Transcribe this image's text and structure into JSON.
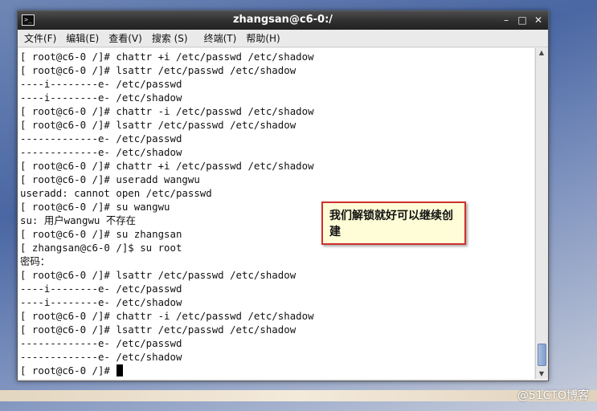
{
  "window": {
    "title": "zhangsan@c6-0:/",
    "controls": {
      "minimize": "–",
      "maximize": "□",
      "close": "✕"
    }
  },
  "menu": [
    {
      "label": "文件(F)"
    },
    {
      "label": "编辑(E)"
    },
    {
      "label": "查看(V)"
    },
    {
      "label": "搜索 (S)"
    },
    {
      "label": "终端(T)"
    },
    {
      "label": "帮助(H)"
    }
  ],
  "terminal": {
    "lines": [
      "[ root@c6-0 /]# chattr +i /etc/passwd /etc/shadow",
      "[ root@c6-0 /]# lsattr /etc/passwd /etc/shadow",
      "----i--------e- /etc/passwd",
      "----i--------e- /etc/shadow",
      "[ root@c6-0 /]# chattr -i /etc/passwd /etc/shadow",
      "[ root@c6-0 /]# lsattr /etc/passwd /etc/shadow",
      "-------------e- /etc/passwd",
      "-------------e- /etc/shadow",
      "[ root@c6-0 /]# chattr +i /etc/passwd /etc/shadow",
      "[ root@c6-0 /]# useradd wangwu",
      "useradd: cannot open /etc/passwd",
      "[ root@c6-0 /]# su wangwu",
      "su: 用户wangwu 不存在",
      "[ root@c6-0 /]# su zhangsan",
      "[ zhangsan@c6-0 /]$ su root",
      "密码：",
      "[ root@c6-0 /]# lsattr /etc/passwd /etc/shadow",
      "----i--------e- /etc/passwd",
      "----i--------e- /etc/shadow",
      "[ root@c6-0 /]# chattr -i /etc/passwd /etc/shadow",
      "[ root@c6-0 /]# lsattr /etc/passwd /etc/shadow",
      "-------------e- /etc/passwd",
      "-------------e- /etc/shadow"
    ],
    "prompt": "[ root@c6-0 /]# "
  },
  "callout": {
    "text": "我们解锁就好可以继续创建"
  },
  "watermark": "@51CTO博客",
  "colors": {
    "callout_border": "#d03030",
    "callout_bg": "#fefdd7",
    "scroll_thumb": "#8aa7d2"
  },
  "icons": [
    "terminal-icon",
    "minimize-icon",
    "maximize-icon",
    "close-icon",
    "scroll-up-icon",
    "scroll-down-icon"
  ]
}
